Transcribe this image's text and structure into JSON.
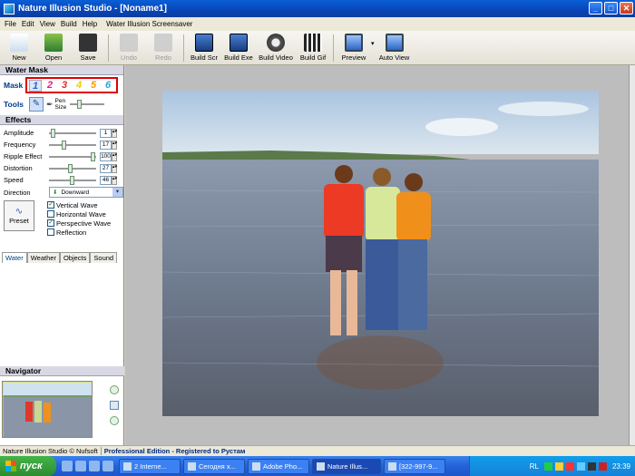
{
  "window": {
    "title": "Nature Illusion Studio - [Noname1]",
    "min": "_",
    "max": "□",
    "close": "✕"
  },
  "menu": [
    "File",
    "Edit",
    "View",
    "Build",
    "Help",
    "Water Illusion Screensaver"
  ],
  "toolbar": [
    {
      "label": "New",
      "icon": "new-icon",
      "enabled": true
    },
    {
      "label": "Open",
      "icon": "open-icon",
      "enabled": true
    },
    {
      "label": "Save",
      "icon": "save-icon",
      "enabled": true
    },
    {
      "label": "Undo",
      "icon": "undo-icon",
      "enabled": false
    },
    {
      "label": "Redo",
      "icon": "redo-icon",
      "enabled": false
    },
    {
      "label": "Build Scr",
      "icon": "build-scr-icon",
      "enabled": true
    },
    {
      "label": "Build Exe",
      "icon": "build-exe-icon",
      "enabled": true
    },
    {
      "label": "Build Video",
      "icon": "build-video-icon",
      "enabled": true
    },
    {
      "label": "Build Gif",
      "icon": "build-gif-icon",
      "enabled": true
    },
    {
      "label": "Preview",
      "icon": "preview-icon",
      "enabled": true
    },
    {
      "label": "Auto View",
      "icon": "auto-view-icon",
      "enabled": true
    }
  ],
  "water_mask": {
    "heading": "Water Mask",
    "mask_label": "Mask",
    "masks": [
      {
        "label": "1",
        "color": "#1a6ad8"
      },
      {
        "label": "2",
        "color": "#e02080"
      },
      {
        "label": "3",
        "color": "#e03030"
      },
      {
        "label": "4",
        "color": "#f0d000"
      },
      {
        "label": "5",
        "color": "#f0a000"
      },
      {
        "label": "6",
        "color": "#20b0e0"
      }
    ],
    "tools_label": "Tools",
    "pen_label_1": "Pen",
    "pen_label_2": "Size"
  },
  "effects": {
    "heading": "Effects",
    "sliders": [
      {
        "label": "Amplitude",
        "value": "1",
        "level": 0.05
      },
      {
        "label": "Frequency",
        "value": "17",
        "level": 0.3
      },
      {
        "label": "Ripple Effect",
        "value": "100",
        "level": 1.0
      },
      {
        "label": "Distortion",
        "value": "27",
        "level": 0.45
      },
      {
        "label": "Speed",
        "value": "46",
        "level": 0.5
      }
    ],
    "direction_label": "Direction",
    "direction_value": "Downward",
    "preset_label": "Preset",
    "checks": [
      {
        "label": "Vertical Wave",
        "checked": true
      },
      {
        "label": "Horizontal Wave",
        "checked": false
      },
      {
        "label": "Perspective Wave",
        "checked": true
      },
      {
        "label": "Reflection",
        "checked": false
      }
    ]
  },
  "tabs": [
    {
      "label": "Water",
      "active": true
    },
    {
      "label": "Weather",
      "active": false
    },
    {
      "label": "Objects",
      "active": false
    },
    {
      "label": "Sound",
      "active": false
    }
  ],
  "navigator": {
    "heading": "Navigator"
  },
  "status": {
    "left": "Nature Illusion Studio © Nufsoft",
    "right": "Professional Edition - Registered to Рустам"
  },
  "taskbar": {
    "start": "пуск",
    "tasks": [
      {
        "label": "2 Interne...",
        "active": false
      },
      {
        "label": "Сегодня х...",
        "active": false
      },
      {
        "label": "Adobe Pho...",
        "active": false
      },
      {
        "label": "Nature Illus...",
        "active": true
      },
      {
        "label": "[322-997-9...",
        "active": false
      }
    ],
    "lang": "RL",
    "clock": "23:39"
  }
}
